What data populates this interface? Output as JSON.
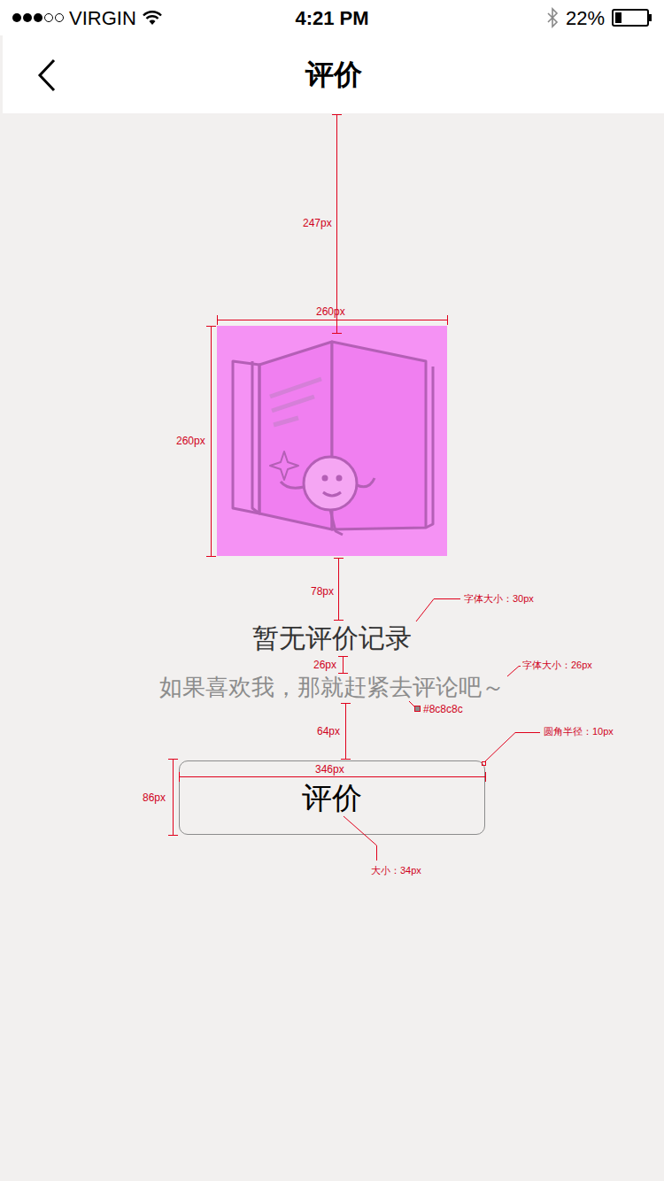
{
  "status_bar": {
    "signal_strength": 3,
    "carrier": "VIRGIN",
    "time": "4:21 PM",
    "battery": "22%",
    "battery_level": 0.22
  },
  "nav": {
    "title": "评价"
  },
  "empty_state": {
    "title": "暂无评价记录",
    "subtitle": "如果喜欢我，那就赶紧去评论吧～",
    "button": "评价"
  },
  "annotations": [
    {
      "text": "247px"
    },
    {
      "text": "260px"
    },
    {
      "text": "260px"
    },
    {
      "text": "78px"
    },
    {
      "text": "字体大小：30px"
    },
    {
      "text": "26px"
    },
    {
      "text": "字体大小：26px"
    },
    {
      "text": "#8c8c8c"
    },
    {
      "text": "64px"
    },
    {
      "text": "圆角半径：10px"
    },
    {
      "text": "346px"
    },
    {
      "text": "86px"
    },
    {
      "text": "大小：34px"
    }
  ]
}
